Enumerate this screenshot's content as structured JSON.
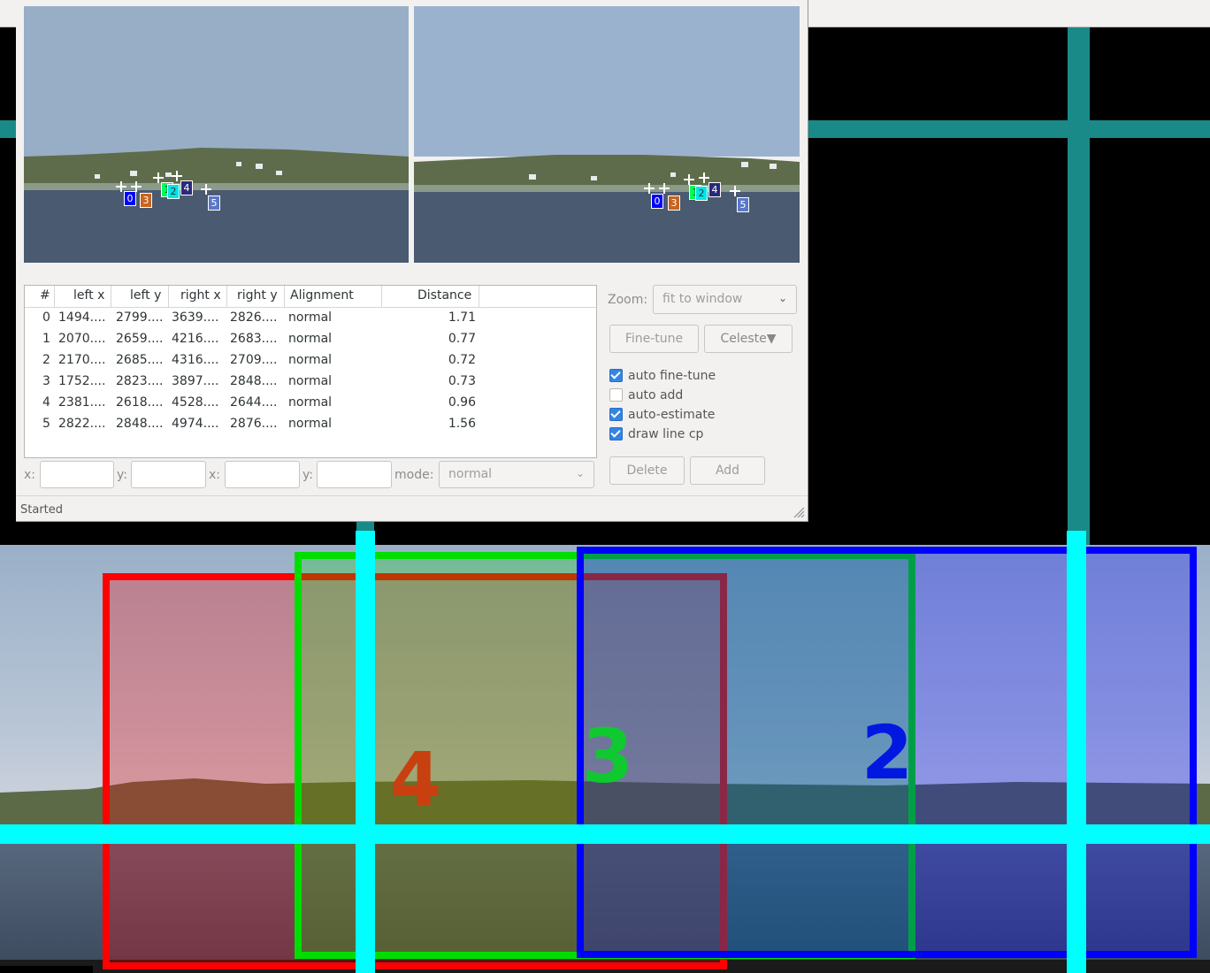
{
  "table": {
    "headers": [
      "#",
      "left x",
      "left y",
      "right x",
      "right y",
      "Alignment",
      "Distance"
    ],
    "rows": [
      [
        "0",
        "1494....",
        "2799....",
        "3639....",
        "2826....",
        "normal",
        "1.71"
      ],
      [
        "1",
        "2070....",
        "2659....",
        "4216....",
        "2683....",
        "normal",
        "0.77"
      ],
      [
        "2",
        "2170....",
        "2685....",
        "4316....",
        "2709....",
        "normal",
        "0.72"
      ],
      [
        "3",
        "1752....",
        "2823....",
        "3897....",
        "2848....",
        "normal",
        "0.73"
      ],
      [
        "4",
        "2381....",
        "2618....",
        "4528....",
        "2644....",
        "normal",
        "0.96"
      ],
      [
        "5",
        "2822....",
        "2848....",
        "4974....",
        "2876....",
        "normal",
        "1.56"
      ]
    ]
  },
  "edit_row": {
    "x1": "x:",
    "y1": "y:",
    "x2": "x:",
    "y2": "y:",
    "mode": "mode:",
    "mode_value": "normal"
  },
  "zoom": {
    "label": "Zoom:",
    "value": "fit to window"
  },
  "buttons": {
    "fine_tune": "Fine-tune",
    "celeste": "Celeste▼",
    "delete": "Delete",
    "add": "Add"
  },
  "options": [
    {
      "label": "auto fine-tune",
      "checked": true
    },
    {
      "label": "auto add",
      "checked": false
    },
    {
      "label": "auto-estimate",
      "checked": true
    },
    {
      "label": "draw line cp",
      "checked": true
    }
  ],
  "status": "Started",
  "control_points": {
    "labels": [
      "0",
      "1",
      "2",
      "3",
      "4",
      "5"
    ],
    "colors": [
      "#0000ff",
      "#00ff55",
      "#00e5e5",
      "#c86420",
      "#2a2a7a",
      "#5a78c8"
    ]
  },
  "preview": {
    "overlay_labels": [
      "4",
      "3",
      "2"
    ],
    "overlay_colors": {
      "4": "#ff0000",
      "3": "#00dd00",
      "2": "#0000ff"
    },
    "label_colors": {
      "4": "#c84010",
      "3": "#10c830",
      "2": "#0018e0"
    }
  }
}
